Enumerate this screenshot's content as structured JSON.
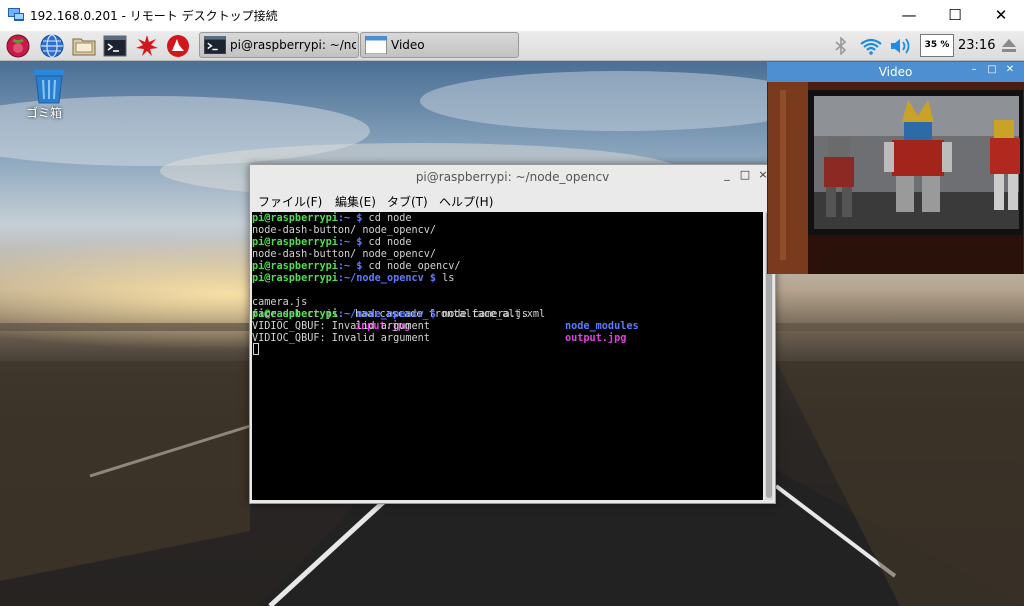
{
  "rdp": {
    "title": "192.168.0.201 - リモート デスクトップ接続",
    "min_glyph": "—",
    "max_glyph": "☐",
    "close_glyph": "✕"
  },
  "panel": {
    "launchers": [
      "raspberry-menu-icon",
      "web-browser-icon",
      "file-manager-icon",
      "terminal-icon",
      "mathematica-icon",
      "wolfram-icon"
    ],
    "tasks": [
      {
        "label": "pi@raspberrypi: ~/no...",
        "icon": "terminal-icon"
      },
      {
        "label": "Video",
        "icon": "window-icon"
      }
    ],
    "cpu": "35 %",
    "clock": "23:16",
    "tray_icons": [
      "bluetooth-icon",
      "wifi-icon",
      "volume-icon",
      "eject-icon"
    ]
  },
  "desktop": {
    "trash_label": "ゴミ箱"
  },
  "terminal": {
    "title": "pi@raspberrypi: ~/node_opencv",
    "min_glyph": "_",
    "max_glyph": "□",
    "close_glyph": "×",
    "menu": [
      "ファイル(F)",
      "編集(E)",
      "タブ(T)",
      "ヘルプ(H)"
    ],
    "prompt_user": "pi@raspberrypi",
    "lines": {
      "l1_path": ":~ $",
      "l1_cmd": " cd node",
      "l2": "node-dash-button/ node_opencv/",
      "l3_path": ":~ $",
      "l3_cmd": " cd node",
      "l4": "node-dash-button/ node_opencv/",
      "l5_path": ":~ $",
      "l5_cmd": " cd node_opencv/",
      "l6_path": ":~/node_opencv $",
      "l6_cmd": " ls",
      "l7_a": "camera.js",
      "l7_b": "haarcascade_frontalface_alt.xml",
      "l7_c": "node_modules",
      "l8_a": "face_detect.js",
      "l8_b": "input.jpg",
      "l8_c": "output.jpg",
      "l9_path": ":~/node_opencv $",
      "l9_cmd": " node camera.js",
      "l10": "VIDIOC_QBUF: Invalid argument",
      "l11": "VIDIOC_QBUF: Invalid argument"
    }
  },
  "video": {
    "title": "Video",
    "min_glyph": "–",
    "max_glyph": "□",
    "close_glyph": "✕"
  }
}
